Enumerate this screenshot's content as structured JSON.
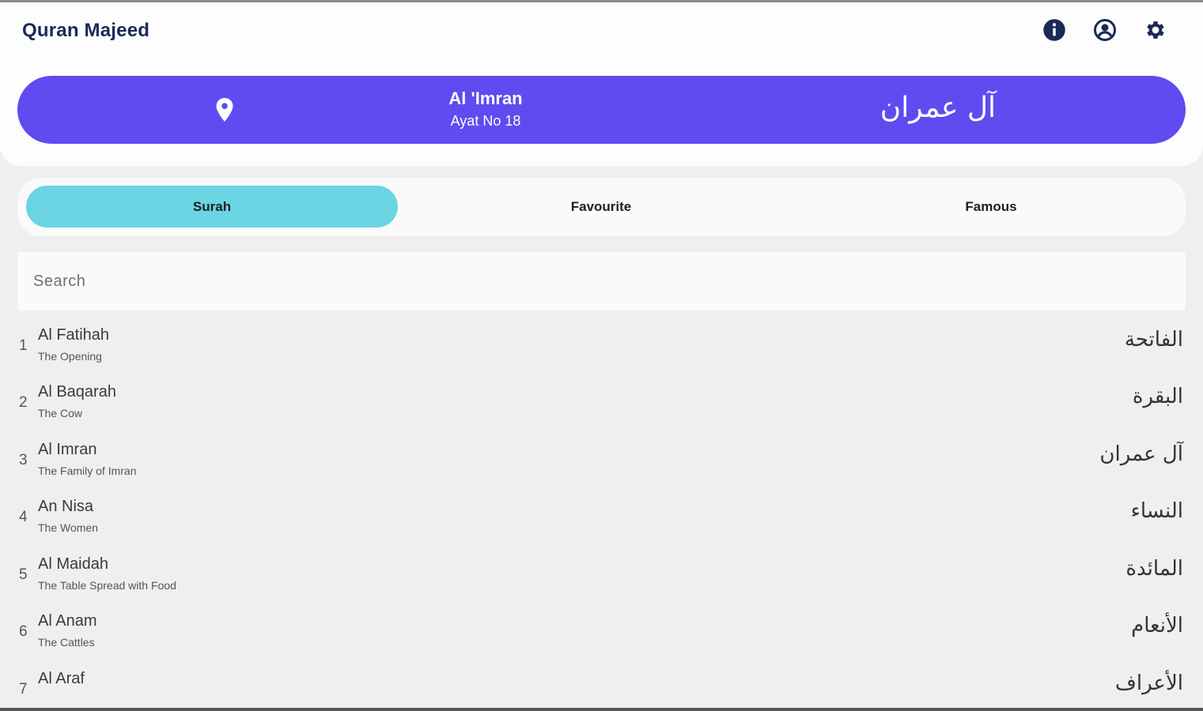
{
  "header": {
    "title": "Quran Majeed",
    "icons": [
      "info-icon",
      "account-icon",
      "settings-icon"
    ]
  },
  "banner": {
    "name": "Al 'Imran",
    "ayat": "Ayat No 18",
    "arabic": "آل عمران"
  },
  "tabs": [
    {
      "label": "Surah",
      "active": true
    },
    {
      "label": "Favourite",
      "active": false
    },
    {
      "label": "Famous",
      "active": false
    }
  ],
  "search": {
    "placeholder": "Search",
    "value": ""
  },
  "surahs": [
    {
      "num": "1",
      "name": "Al Fatihah",
      "meaning": "The Opening",
      "arabic": "الفاتحة"
    },
    {
      "num": "2",
      "name": "Al Baqarah",
      "meaning": "The Cow",
      "arabic": "البقرة"
    },
    {
      "num": "3",
      "name": "Al Imran",
      "meaning": "The Family of Imran",
      "arabic": "آل عمران"
    },
    {
      "num": "4",
      "name": "An Nisa",
      "meaning": "The Women",
      "arabic": "النساء"
    },
    {
      "num": "5",
      "name": "Al Maidah",
      "meaning": "The Table Spread with Food",
      "arabic": "المائدة"
    },
    {
      "num": "6",
      "name": "Al Anam",
      "meaning": "The Cattles",
      "arabic": "الأنعام"
    },
    {
      "num": "7",
      "name": "Al Araf",
      "meaning": "",
      "arabic": "الأعراف"
    }
  ],
  "colors": {
    "accent": "#5f4bf0",
    "tab_active": "#6ad4e3",
    "title": "#1a2a55"
  }
}
